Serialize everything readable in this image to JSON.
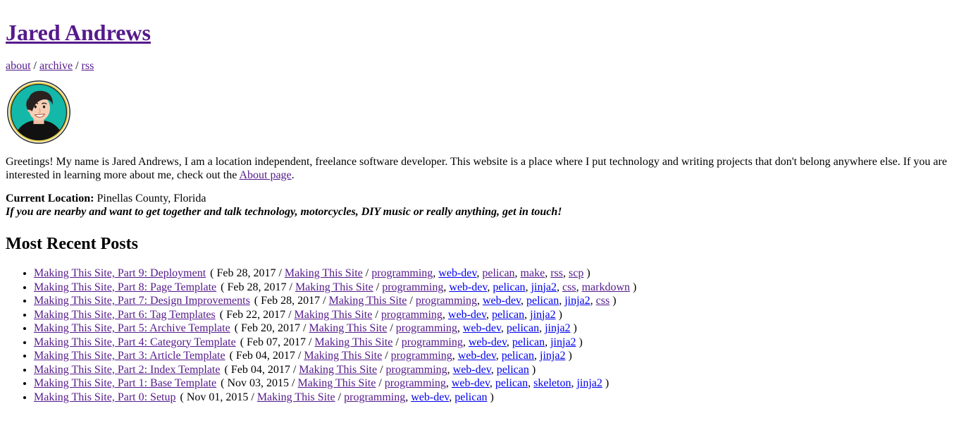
{
  "site": {
    "title": "Jared Andrews",
    "title_link_state": "visited"
  },
  "nav": {
    "separator": "/",
    "items": [
      {
        "label": "about",
        "state": "visited"
      },
      {
        "label": "archive",
        "state": "visited"
      },
      {
        "label": "rss",
        "state": "visited"
      }
    ]
  },
  "avatar": {
    "name": "avatar-portrait",
    "ring_color": "#e8d44d",
    "background_color": "#13b8a8",
    "outline_color": "#1b1b1b",
    "hair_color": "#2b2020",
    "skin_color": "#f7cfb5",
    "shirt_color": "#111111"
  },
  "intro": {
    "text_before_link": "Greetings! My name is Jared Andrews, I am a location independent, freelance software developer. This website is a place where I put technology and writing projects that don't belong anywhere else. If you are interested in learning more about me, check out the ",
    "link_label": "About page",
    "link_state": "visited",
    "text_after_link": "."
  },
  "location": {
    "label": "Current Location:",
    "value": " Pinellas County, Florida",
    "note": "If you are nearby and want to get together and talk technology, motorcycles, DIY music or really anything, get in touch!"
  },
  "recent_posts": {
    "heading": "Most Recent Posts",
    "open_paren": "(",
    "close_paren": ")",
    "separator": "/",
    "comma": ",",
    "items": [
      {
        "title": "Making This Site, Part 9: Deployment",
        "title_state": "visited",
        "date": "Feb 28, 2017",
        "category": "Making This Site",
        "category_state": "visited",
        "tags": [
          {
            "label": "programming",
            "state": "visited"
          },
          {
            "label": "web-dev",
            "state": "unvisited"
          },
          {
            "label": "pelican",
            "state": "visited"
          },
          {
            "label": "make",
            "state": "visited"
          },
          {
            "label": "rss",
            "state": "visited"
          },
          {
            "label": "scp",
            "state": "visited"
          }
        ]
      },
      {
        "title": "Making This Site, Part 8: Page Template",
        "title_state": "visited",
        "date": "Feb 28, 2017",
        "category": "Making This Site",
        "category_state": "visited",
        "tags": [
          {
            "label": "programming",
            "state": "visited"
          },
          {
            "label": "web-dev",
            "state": "unvisited"
          },
          {
            "label": "pelican",
            "state": "unvisited"
          },
          {
            "label": "jinja2",
            "state": "unvisited"
          },
          {
            "label": "css",
            "state": "visited"
          },
          {
            "label": "markdown",
            "state": "visited"
          }
        ]
      },
      {
        "title": "Making This Site, Part 7: Design Improvements",
        "title_state": "visited",
        "date": "Feb 28, 2017",
        "category": "Making This Site",
        "category_state": "visited",
        "tags": [
          {
            "label": "programming",
            "state": "visited"
          },
          {
            "label": "web-dev",
            "state": "unvisited"
          },
          {
            "label": "pelican",
            "state": "unvisited"
          },
          {
            "label": "jinja2",
            "state": "unvisited"
          },
          {
            "label": "css",
            "state": "visited"
          }
        ]
      },
      {
        "title": "Making This Site, Part 6: Tag Templates",
        "title_state": "visited",
        "date": "Feb 22, 2017",
        "category": "Making This Site",
        "category_state": "visited",
        "tags": [
          {
            "label": "programming",
            "state": "visited"
          },
          {
            "label": "web-dev",
            "state": "unvisited"
          },
          {
            "label": "pelican",
            "state": "unvisited"
          },
          {
            "label": "jinja2",
            "state": "unvisited"
          }
        ]
      },
      {
        "title": "Making This Site, Part 5: Archive Template",
        "title_state": "visited",
        "date": "Feb 20, 2017",
        "category": "Making This Site",
        "category_state": "visited",
        "tags": [
          {
            "label": "programming",
            "state": "visited"
          },
          {
            "label": "web-dev",
            "state": "unvisited"
          },
          {
            "label": "pelican",
            "state": "unvisited"
          },
          {
            "label": "jinja2",
            "state": "unvisited"
          }
        ]
      },
      {
        "title": "Making This Site, Part 4: Category Template",
        "title_state": "visited",
        "date": "Feb 07, 2017",
        "category": "Making This Site",
        "category_state": "visited",
        "tags": [
          {
            "label": "programming",
            "state": "visited"
          },
          {
            "label": "web-dev",
            "state": "unvisited"
          },
          {
            "label": "pelican",
            "state": "unvisited"
          },
          {
            "label": "jinja2",
            "state": "unvisited"
          }
        ]
      },
      {
        "title": "Making This Site, Part 3: Article Template",
        "title_state": "visited",
        "date": "Feb 04, 2017",
        "category": "Making This Site",
        "category_state": "visited",
        "tags": [
          {
            "label": "programming",
            "state": "visited"
          },
          {
            "label": "web-dev",
            "state": "unvisited"
          },
          {
            "label": "pelican",
            "state": "unvisited"
          },
          {
            "label": "jinja2",
            "state": "unvisited"
          }
        ]
      },
      {
        "title": "Making This Site, Part 2: Index Template",
        "title_state": "visited",
        "date": "Feb 04, 2017",
        "category": "Making This Site",
        "category_state": "visited",
        "tags": [
          {
            "label": "programming",
            "state": "visited"
          },
          {
            "label": "web-dev",
            "state": "unvisited"
          },
          {
            "label": "pelican",
            "state": "unvisited"
          }
        ]
      },
      {
        "title": "Making This Site, Part 1: Base Template",
        "title_state": "visited",
        "date": "Nov 03, 2015",
        "category": "Making This Site",
        "category_state": "visited",
        "tags": [
          {
            "label": "programming",
            "state": "visited"
          },
          {
            "label": "web-dev",
            "state": "unvisited"
          },
          {
            "label": "pelican",
            "state": "unvisited"
          },
          {
            "label": "skeleton",
            "state": "unvisited"
          },
          {
            "label": "jinja2",
            "state": "unvisited"
          }
        ]
      },
      {
        "title": "Making This Site, Part 0: Setup",
        "title_state": "visited",
        "date": "Nov 01, 2015",
        "category": "Making This Site",
        "category_state": "visited",
        "tags": [
          {
            "label": "programming",
            "state": "visited"
          },
          {
            "label": "web-dev",
            "state": "unvisited"
          },
          {
            "label": "pelican",
            "state": "unvisited"
          }
        ]
      }
    ]
  },
  "colors": {
    "visited_link": "#551a8b",
    "unvisited_link": "#0000ee",
    "text": "#000000",
    "background": "#ffffff"
  }
}
